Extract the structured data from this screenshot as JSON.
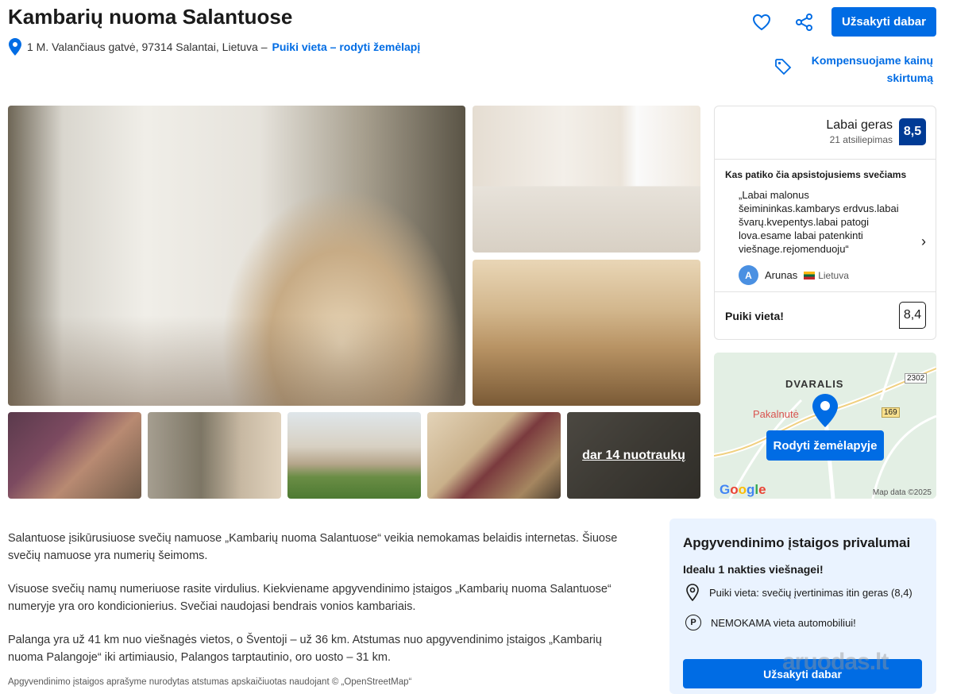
{
  "header": {
    "title": "Kambarių nuoma Salantuose",
    "address": "1 M. Valančiaus gatvė, 97314 Salantai, Lietuva –",
    "map_link": "Puiki vieta – rodyti žemėlapį",
    "book_label": "Užsakyti dabar",
    "price_match": "Kompensuojame kainų skirtumą"
  },
  "gallery": {
    "more_photos": "dar 14 nuotraukų"
  },
  "review": {
    "rating_word": "Labai geras",
    "rating_count": "21 atsiliepimas",
    "score": "8,5",
    "liked_heading": "Kas patiko čia apsistojusiems svečiams",
    "quote": "„Labai malonus šeimininkas.kambarys erdvus.labai švarų.kvepentys.labai patogi lova.esame labai patenkinti viešnage.rejomenduoju“",
    "avatar_letter": "A",
    "reviewer": "Arunas",
    "country": "Lietuva",
    "location_label": "Puiki vieta!",
    "location_score": "8,4"
  },
  "map": {
    "label_dvaralis": "DVARALIS",
    "label_pakalnute": "Pakalnutė",
    "road_2302": "2302",
    "road_169": "169",
    "button": "Rodyti žemėlapyje",
    "google": "Google",
    "map_data": "Map data ©2025"
  },
  "description": {
    "p1": "Salantuose įsikūrusiuose svečių namuose „Kambarių nuoma Salantuose“ veikia nemokamas belaidis internetas. Šiuose svečių namuose yra numerių šeimoms.",
    "p2": "Visuose svečių namų numeriuose rasite virdulius. Kiekviename apgyvendinimo įstaigos „Kambarių nuoma Salantuose“ numeryje yra oro kondicionierius. Svečiai naudojasi bendrais vonios kambariais.",
    "p3": "Palanga yra už 41 km nuo viešnagės vietos, o Šventoji – už 36 km. Atstumas nuo apgyvendinimo įstaigos „Kambarių nuoma Palangoje“ iki artimiausio, Palangos tarptautinio, oro uosto – 31 km.",
    "footnote": "Apgyvendinimo įstaigos aprašyme nurodytas atstumas apskaičiuotas naudojant © „OpenStreetMap“"
  },
  "perks": {
    "title": "Apgyvendinimo įstaigos privalumai",
    "ideal": "Idealu 1 nakties viešnagei!",
    "perk1": "Puiki vieta: svečių įvertinimas itin geras (8,4)",
    "perk2": "NEMOKAMA vieta automobiliui!",
    "parking_letter": "P",
    "book_label": "Užsakyti dabar"
  },
  "watermark": "aruodas.lt",
  "colors": {
    "primary": "#006ce4",
    "score_bg": "#003b95",
    "perks_bg": "#eaf3ff"
  }
}
